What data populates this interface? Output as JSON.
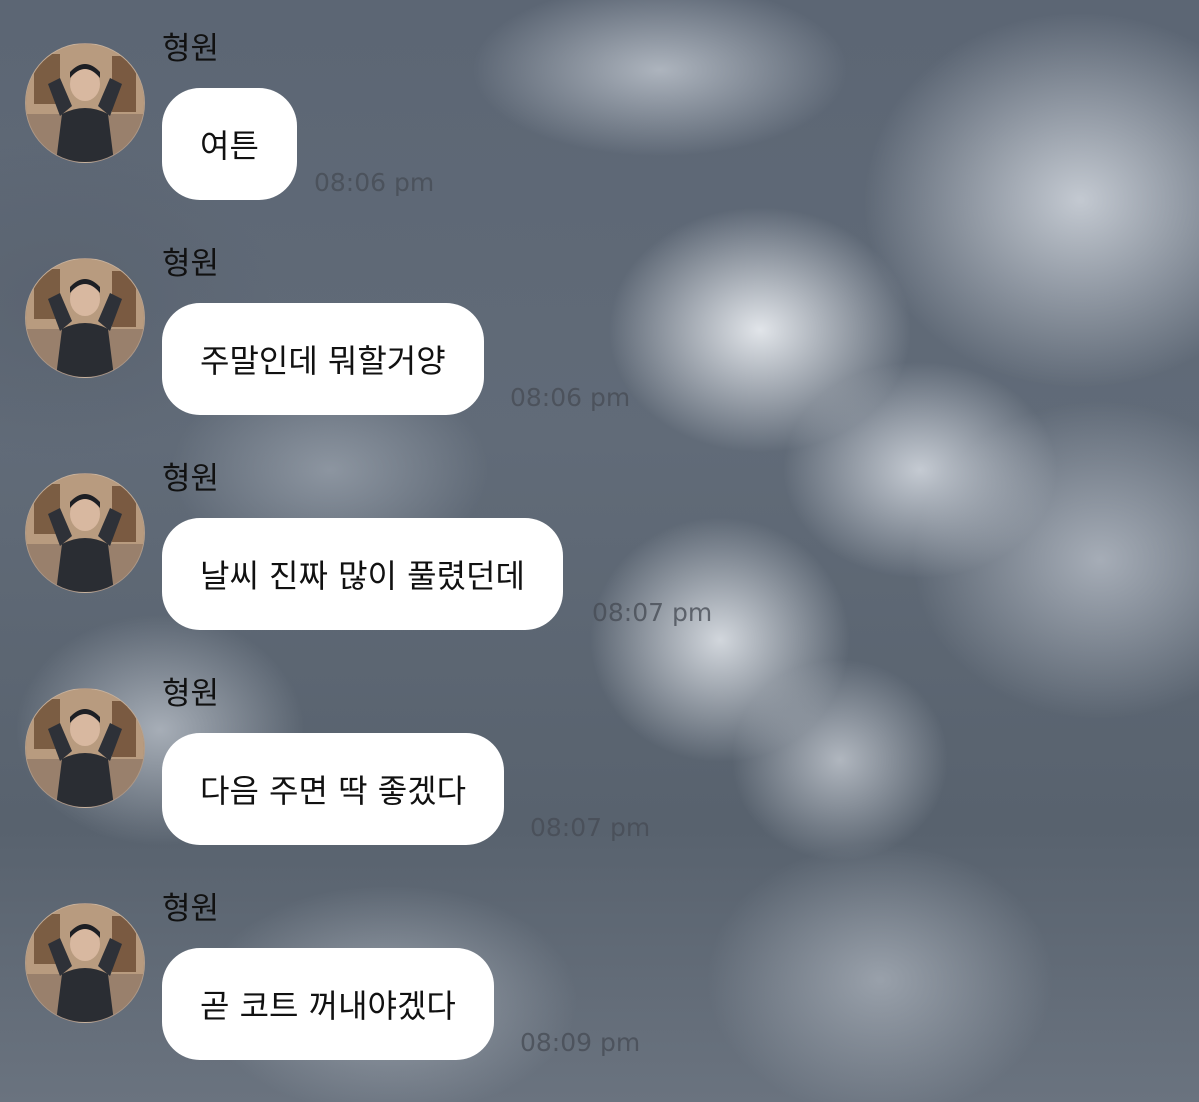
{
  "messages": [
    {
      "sender": "형원",
      "text": "여튼",
      "time": "08:06 pm",
      "avatar_icon": "profile-photo"
    },
    {
      "sender": "형원",
      "text": "주말인데 뭐할거양",
      "time": "08:06 pm",
      "avatar_icon": "profile-photo"
    },
    {
      "sender": "형원",
      "text": "날씨 진짜 많이 풀렸던데",
      "time": "08:07 pm",
      "avatar_icon": "profile-photo"
    },
    {
      "sender": "형원",
      "text": "다음 주면 딱 좋겠다",
      "time": "08:07 pm",
      "avatar_icon": "profile-photo"
    },
    {
      "sender": "형원",
      "text": "곧 코트 꺼내야겠다",
      "time": "08:09 pm",
      "avatar_icon": "profile-photo"
    }
  ],
  "colors": {
    "bubble": "#ffffff",
    "text": "#111111",
    "timestamp": "#464c54"
  }
}
